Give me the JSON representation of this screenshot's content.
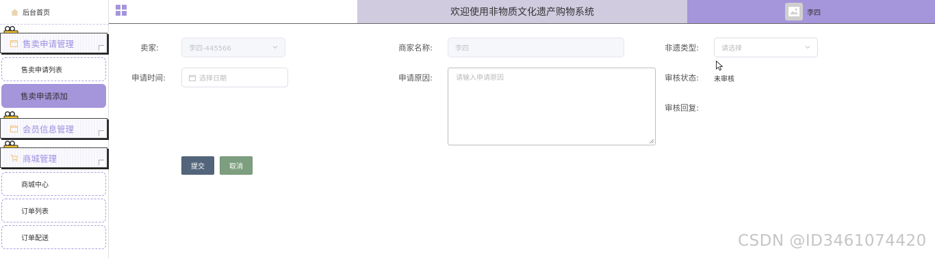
{
  "sidebar": {
    "home_label": "后台首页",
    "groups": {
      "sell": "售卖申请管理",
      "member": "会员信息管理",
      "mall": "商城管理"
    },
    "items": {
      "sell_list": "售卖申请列表",
      "sell_add": "售卖申请添加",
      "mall_center": "商城中心",
      "order_list": "订单列表",
      "order_delivery": "订单配送"
    }
  },
  "header": {
    "title": "欢迎使用非物质文化遗产购物系统",
    "user_name": "李四"
  },
  "form": {
    "seller_label": "卖家:",
    "seller_value": "李四-445566",
    "merchant_label": "商家名称:",
    "merchant_value": "李四",
    "type_label": "非遗类型:",
    "type_placeholder": "请选择",
    "apply_time_label": "申请时间:",
    "apply_time_placeholder": "选择日期",
    "reason_label": "申请原因:",
    "reason_placeholder": "请输入申请原因",
    "review_status_label": "审核状态:",
    "review_status_value": "未审核",
    "review_reply_label": "审核回复:",
    "submit_label": "提交",
    "cancel_label": "取消"
  },
  "watermark": "CSDN @ID3461074420",
  "colors": {
    "accent": "#a595db",
    "header_title_bg": "#d1cbe0",
    "submit_bg": "#53657a",
    "cancel_bg": "#7e9f7f"
  }
}
